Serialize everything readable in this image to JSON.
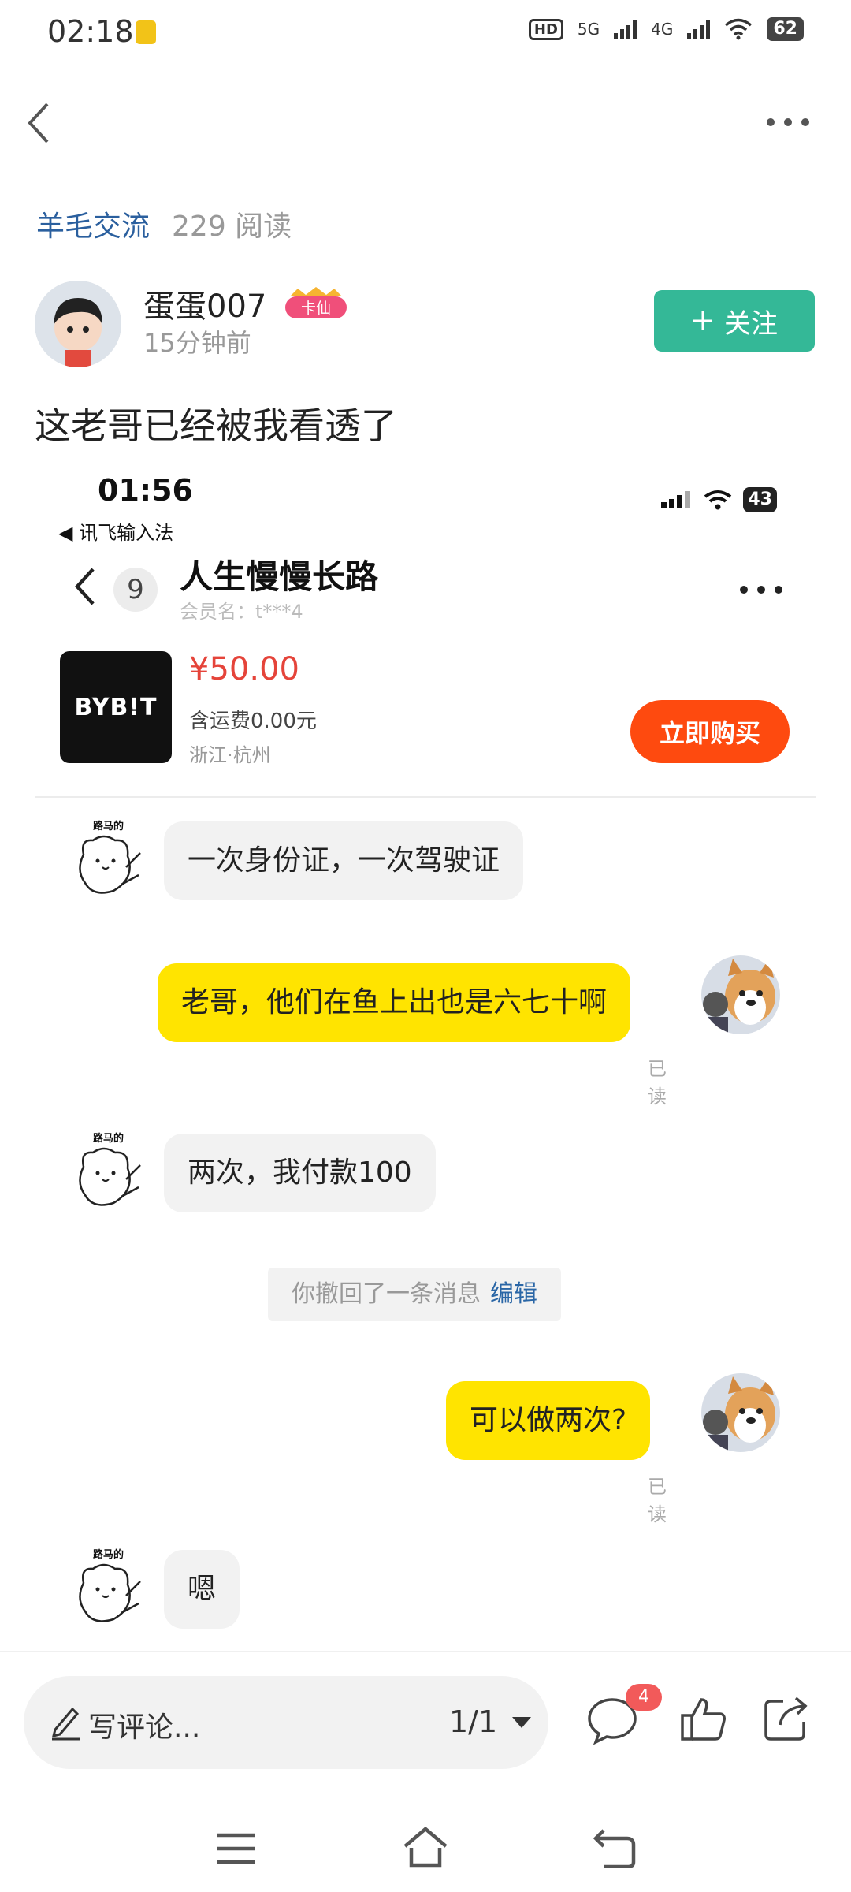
{
  "status_bar": {
    "time": "02:18",
    "network_hd": "HD",
    "net1": "5G",
    "net2": "4G",
    "battery": "62"
  },
  "post": {
    "group": "羊毛交流",
    "reads": "229 阅读",
    "author_name": "蛋蛋007",
    "author_badge": "卡仙",
    "time_ago": "15分钟前",
    "follow_label": "关注",
    "title": "这老哥已经被我看透了"
  },
  "screenshot": {
    "time": "01:56",
    "ime": "◀ 讯飞输入法",
    "battery": "43",
    "unread": "9",
    "chat_name": "人生慢慢长路",
    "member": "会员名：t***4",
    "product": {
      "logo": "BYB!T",
      "price": "¥50.00",
      "shipping": "含运费0.00元",
      "location": "浙江·杭州",
      "buy_label": "立即购买"
    },
    "messages": [
      {
        "side": "left",
        "avatar_text": "路马的",
        "text": "一次身份证，一次驾驶证"
      },
      {
        "side": "right",
        "text": "老哥，他们在鱼上出也是六七十啊",
        "status": "已读"
      },
      {
        "side": "left",
        "avatar_text": "路马的",
        "text": "两次，我付款100"
      },
      {
        "side": "right",
        "text": "可以做两次?",
        "status": "已读"
      },
      {
        "side": "left",
        "avatar_text": "路马的",
        "text": "嗯"
      }
    ],
    "system_note": "你撤回了一条消息",
    "system_note_action": "编辑"
  },
  "bottom_bar": {
    "comment_placeholder": "写评论...",
    "page_indicator": "1/1",
    "comment_count": "4"
  },
  "colors": {
    "accent_green": "#34b897",
    "link_blue": "#2a5f9e",
    "bubble_yellow": "#ffe400",
    "buy_orange": "#fe4a0f",
    "price_red": "#e5443a",
    "badge_red": "#f25a5a"
  }
}
